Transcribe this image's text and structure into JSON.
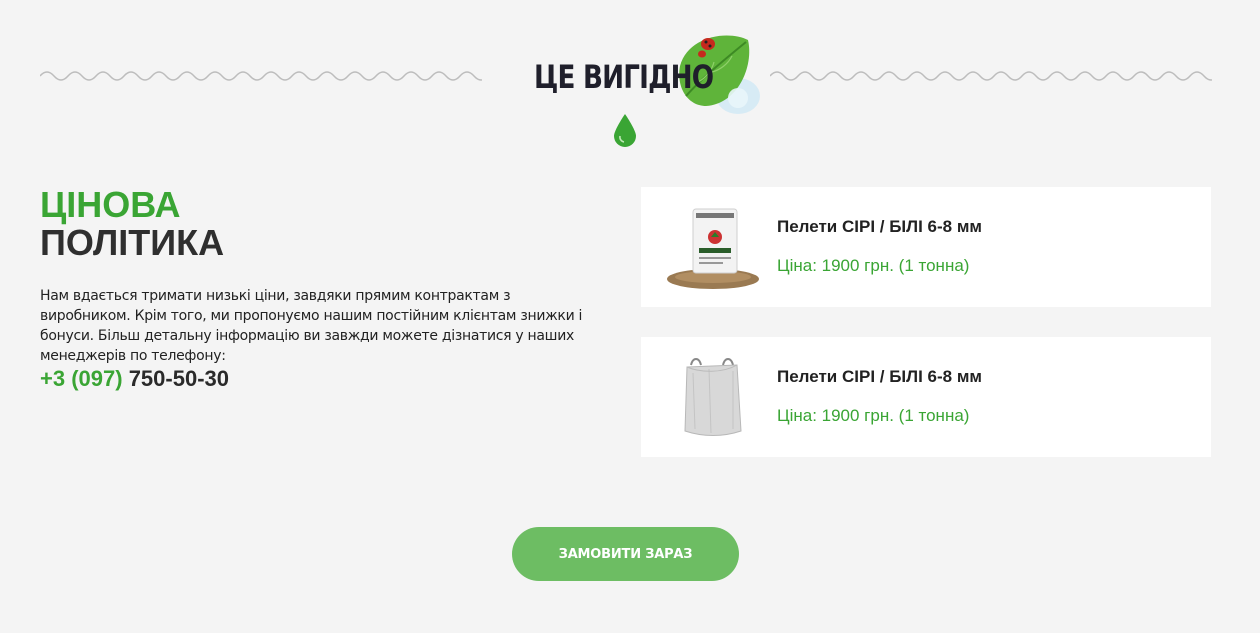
{
  "section": {
    "title": "ЦЕ ВИГІДНО"
  },
  "pricing": {
    "heading_line1": "ЦІНОВА",
    "heading_line2": "ПОЛІТИКА",
    "description": "Нам вдається тримати низькі ціни, завдяки прямим контрактам з виробником. Крім того, ми пропонуємо нашим постійним клієнтам знижки і бонуси. Більш детальну інформацію ви завжди можете дізнатися у наших менеджерів по телефону:",
    "phone_code": "+3 (097)",
    "phone_number": "750-50-30"
  },
  "products": [
    {
      "name": "Пелети СІРІ / БІЛІ 6-8 мм",
      "price": "Ціна: 1900 грн. (1 тонна)",
      "image": "woodlets-bag-icon"
    },
    {
      "name": "Пелети СІРІ / БІЛІ 6-8 мм",
      "price": "Ціна: 1900 грн. (1 тонна)",
      "image": "big-bag-icon"
    }
  ],
  "cta": {
    "label": "ЗАМОВИТИ ЗАРАЗ"
  },
  "colors": {
    "accent": "#3aa534",
    "button": "#6dbd63",
    "background": "#f4f4f4",
    "text_dark": "#2f2f2f"
  }
}
